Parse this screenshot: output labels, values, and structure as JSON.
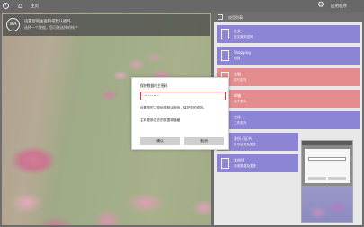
{
  "topbar": {
    "back_icon": "back-arrow-icon",
    "home_icon": "home-icon",
    "title": "主页",
    "settings_icon": "gear-icon",
    "settings_label": "应用程序"
  },
  "banner": {
    "avatar_text": "≡A",
    "title": "设置您的主密码或默认密码",
    "subtitle": "选择一个数据，您可能选择的帐户"
  },
  "panel": {
    "header_label": "应用列表",
    "tiles": [
      {
        "title": "社交",
        "subtitle": "社交媒体密码",
        "color": "#8c85d6"
      },
      {
        "title": "Shopping",
        "subtitle": "购物",
        "color": "#8c85d6"
      },
      {
        "title": "金融",
        "subtitle": "银行密码",
        "color": "#e58c8f"
      },
      {
        "title": "邮箱",
        "subtitle": "电子邮件",
        "color": "#e58c8f"
      },
      {
        "title": "工作",
        "subtitle": "工作密码",
        "color": "#8c85d6"
      },
      {
        "title": "身份 / 证书",
        "subtitle": "身份证明及更多",
        "color": "#8c85d6"
      },
      {
        "title": "其他项",
        "subtitle": "其他数据及更多",
        "color": "#8c85d6"
      }
    ]
  },
  "dialog": {
    "title": "保护数据的主密码",
    "input_placeholder": "••••••••",
    "description": "设置您的主密码或默认密码，保护您的密码。",
    "link": "主码更新过去的数据将隐藏",
    "ok_label": "确认",
    "cancel_label": "取消",
    "input_border_color": "#d4393e"
  }
}
